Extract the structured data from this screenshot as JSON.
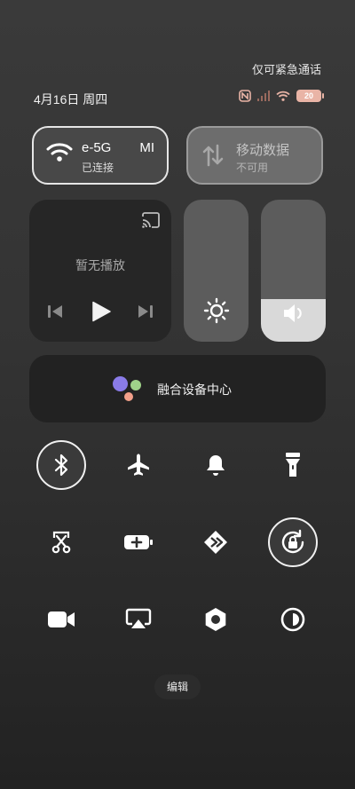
{
  "status_bar": {
    "emergency_text": "仅可紧急通话",
    "datetime": "4月16日 周四",
    "battery_level": "20"
  },
  "wifi": {
    "name": "e-5G",
    "name_extra": "MI",
    "status": "已连接"
  },
  "mobile_data": {
    "name": "移动数据",
    "status": "不可用"
  },
  "media": {
    "status": "暂无播放"
  },
  "brightness_level": 0.0,
  "volume_level": 0.3,
  "fusion": {
    "label": "融合设备中心",
    "dot_colors": [
      "#8a7be8",
      "#9fd389",
      "#f2a08a"
    ]
  },
  "toggles": [
    {
      "icon": "bluetooth-icon",
      "active": true
    },
    {
      "icon": "airplane-icon",
      "active": false
    },
    {
      "icon": "bell-icon",
      "active": false
    },
    {
      "icon": "flashlight-icon",
      "active": false
    },
    {
      "icon": "screenshot-scissors-icon",
      "active": false
    },
    {
      "icon": "battery-saver-icon",
      "active": false
    },
    {
      "icon": "arrow-diamond-icon",
      "active": false
    },
    {
      "icon": "rotation-lock-icon",
      "active": true
    },
    {
      "icon": "video-camera-icon",
      "active": false
    },
    {
      "icon": "screen-cast-icon",
      "active": false
    },
    {
      "icon": "hexagon-settings-icon",
      "active": false
    },
    {
      "icon": "dark-mode-icon",
      "active": false
    }
  ],
  "edit_label": "编辑"
}
